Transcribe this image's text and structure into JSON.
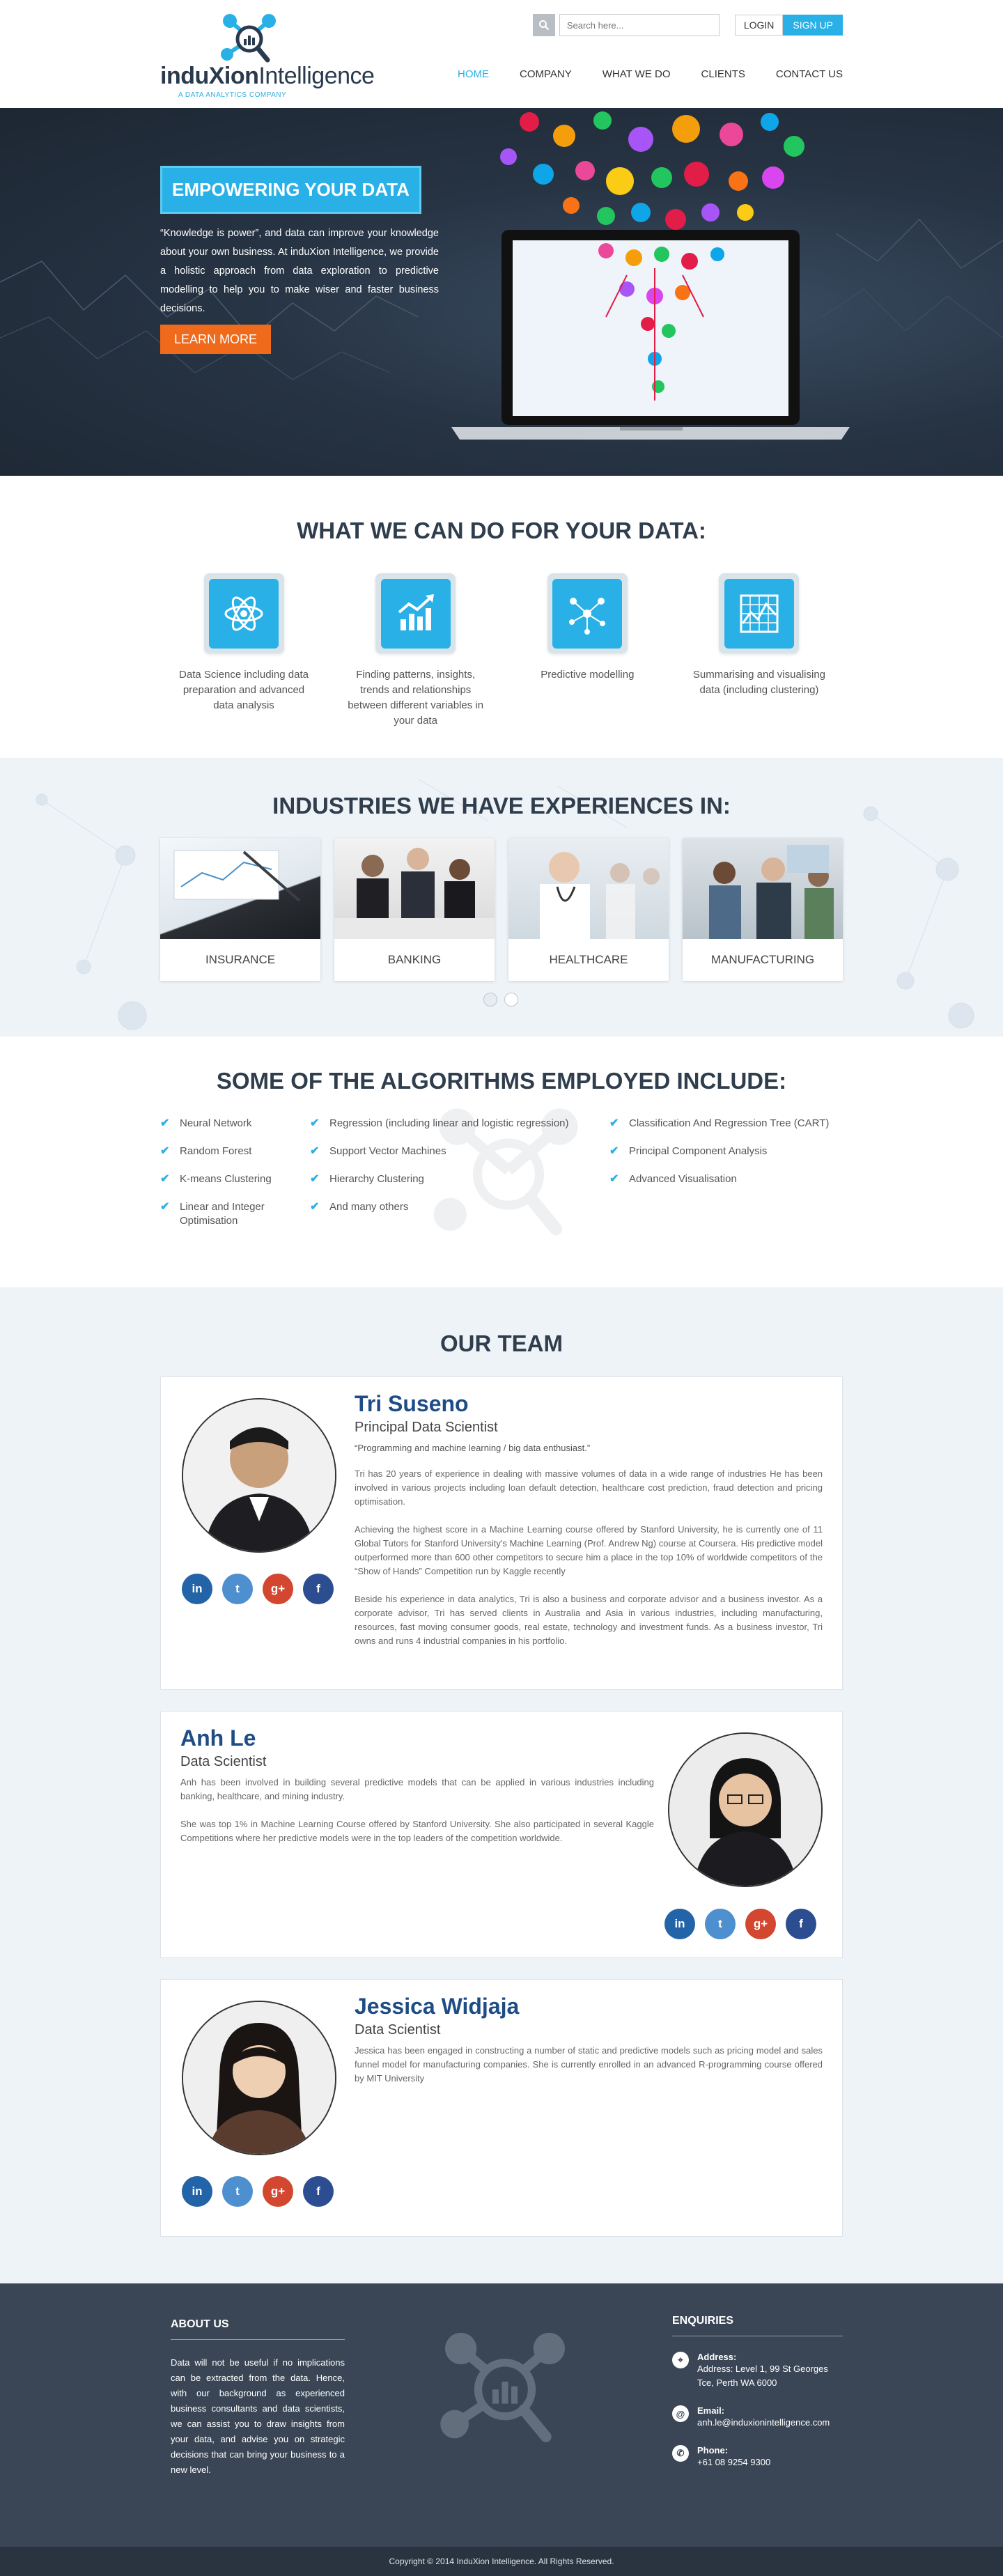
{
  "brand": {
    "name_bold": "induXion",
    "name_light": "Intelligence",
    "tagline": "A DATA ANALYTICS COMPANY"
  },
  "header": {
    "search_placeholder": "Search here...",
    "login_label": "LOGIN",
    "signup_label": "SIGN UP",
    "nav": [
      {
        "label": "HOME",
        "active": true
      },
      {
        "label": "COMPANY",
        "active": false
      },
      {
        "label": "WHAT WE DO",
        "active": false
      },
      {
        "label": "CLIENTS",
        "active": false
      },
      {
        "label": "CONTACT US",
        "active": false
      }
    ]
  },
  "hero": {
    "title": "EMPOWERING YOUR DATA",
    "text": "“Knowledge is power”, and data can improve your knowledge about your own business. At induXion Intelligence, we provide a holistic approach from data exploration to predictive modelling to help you to make wiser and faster business decisions.",
    "button_label": "LEARN MORE"
  },
  "services": {
    "title": "WHAT WE CAN DO FOR YOUR DATA:",
    "items": [
      {
        "text": "Data Science including data preparation and advanced data analysis",
        "icon": "atom-icon"
      },
      {
        "text": "Finding patterns, insights, trends and relationships between different variables in your data",
        "icon": "trend-chart-icon"
      },
      {
        "text": "Predictive modelling",
        "icon": "network-icon"
      },
      {
        "text": "Summarising and visualising data (including clustering)",
        "icon": "grid-chart-icon"
      }
    ]
  },
  "industries": {
    "title": "INDUSTRIES WE HAVE EXPERIENCES IN:",
    "items": [
      {
        "label": "INSURANCE"
      },
      {
        "label": "BANKING"
      },
      {
        "label": "HEALTHCARE"
      },
      {
        "label": "MANUFACTURING"
      }
    ]
  },
  "algorithms": {
    "title": "SOME OF THE ALGORITHMS EMPLOYED INCLUDE:",
    "col1": [
      "Neural Network",
      "Random Forest",
      "K-means Clustering",
      "Linear and Integer Optimisation"
    ],
    "col2": [
      "Regression (including linear and logistic regression)",
      "Support Vector Machines",
      "Hierarchy Clustering",
      "And many others"
    ],
    "col3": [
      "Classification And Regression Tree (CART)",
      "Principal Component Analysis",
      "Advanced Visualisation"
    ]
  },
  "team": {
    "title": "OUR TEAM",
    "members": [
      {
        "name": "Tri Suseno",
        "role": "Principal Data Scientist",
        "quote": "“Programming and machine learning / big data enthusiast.”",
        "paras": [
          "Tri has 20 years of experience in dealing with massive volumes of data in a wide range of industries He has been involved in various projects including loan default detection, healthcare cost prediction, fraud detection and pricing optimisation.",
          "Achieving the highest score in a Machine Learning course offered by Stanford University, he is currently one of 11 Global Tutors for Stanford University's Machine Learning (Prof. Andrew Ng) course at Coursera. His predictive model outperformed more than 600 other competitors to secure him a place in the top 10% of worldwide competitors of the “Show of Hands” Competition run by Kaggle recently",
          "Beside his experience in data analytics, Tri is also a business and corporate advisor and a business investor. As a corporate advisor, Tri has served clients in Australia and Asia in various industries, including manufacturing, resources, fast moving consumer goods, real estate, technology and investment funds. As a business investor, Tri owns and runs 4 industrial companies in his portfolio."
        ]
      },
      {
        "name": "Anh Le",
        "role": "Data Scientist",
        "paras": [
          "Anh has been involved in building several predictive models that can be applied in various industries including banking, healthcare, and mining industry.",
          "She was top 1% in Machine Learning Course offered by Stanford University. She also participated in several Kaggle Competitions where her predictive models were in the top leaders of the competition worldwide."
        ]
      },
      {
        "name": "Jessica Widjaja",
        "role": "Data Scientist",
        "paras": [
          "Jessica has been engaged in constructing a number of static and predictive models such as pricing model and sales funnel model for manufacturing companies. She is currently enrolled in an advanced R-programming course offered by MIT University"
        ]
      }
    ],
    "social": {
      "linkedin": "in",
      "twitter": "t",
      "googleplus": "g+",
      "facebook": "f"
    }
  },
  "footer": {
    "about_title": "ABOUT US",
    "about_text": "Data will not be useful if no implications can be extracted from the data. Hence, with our background as experienced business consultants and data scientists, we can assist you to draw insights from your data, and advise you on strategic decisions that can bring your business to a new level.",
    "enquiries_title": "ENQUIRIES",
    "address_label": "Address:",
    "address_value": "Address: Level 1, 99 St Georges Tce, Perth WA 6000",
    "email_label": "Email:",
    "email_value": "anh.le@induxionintelligence.com",
    "phone_label": "Phone:",
    "phone_value": "+61 08 9254 9300",
    "copyright": "Copyright © 2014 InduXion Intelligence. All Rights Reserved."
  },
  "colors": {
    "accent": "#29b0e6",
    "orange": "#f06a1b",
    "dark": "#2f3d4c",
    "name_blue": "#1e4c85"
  }
}
